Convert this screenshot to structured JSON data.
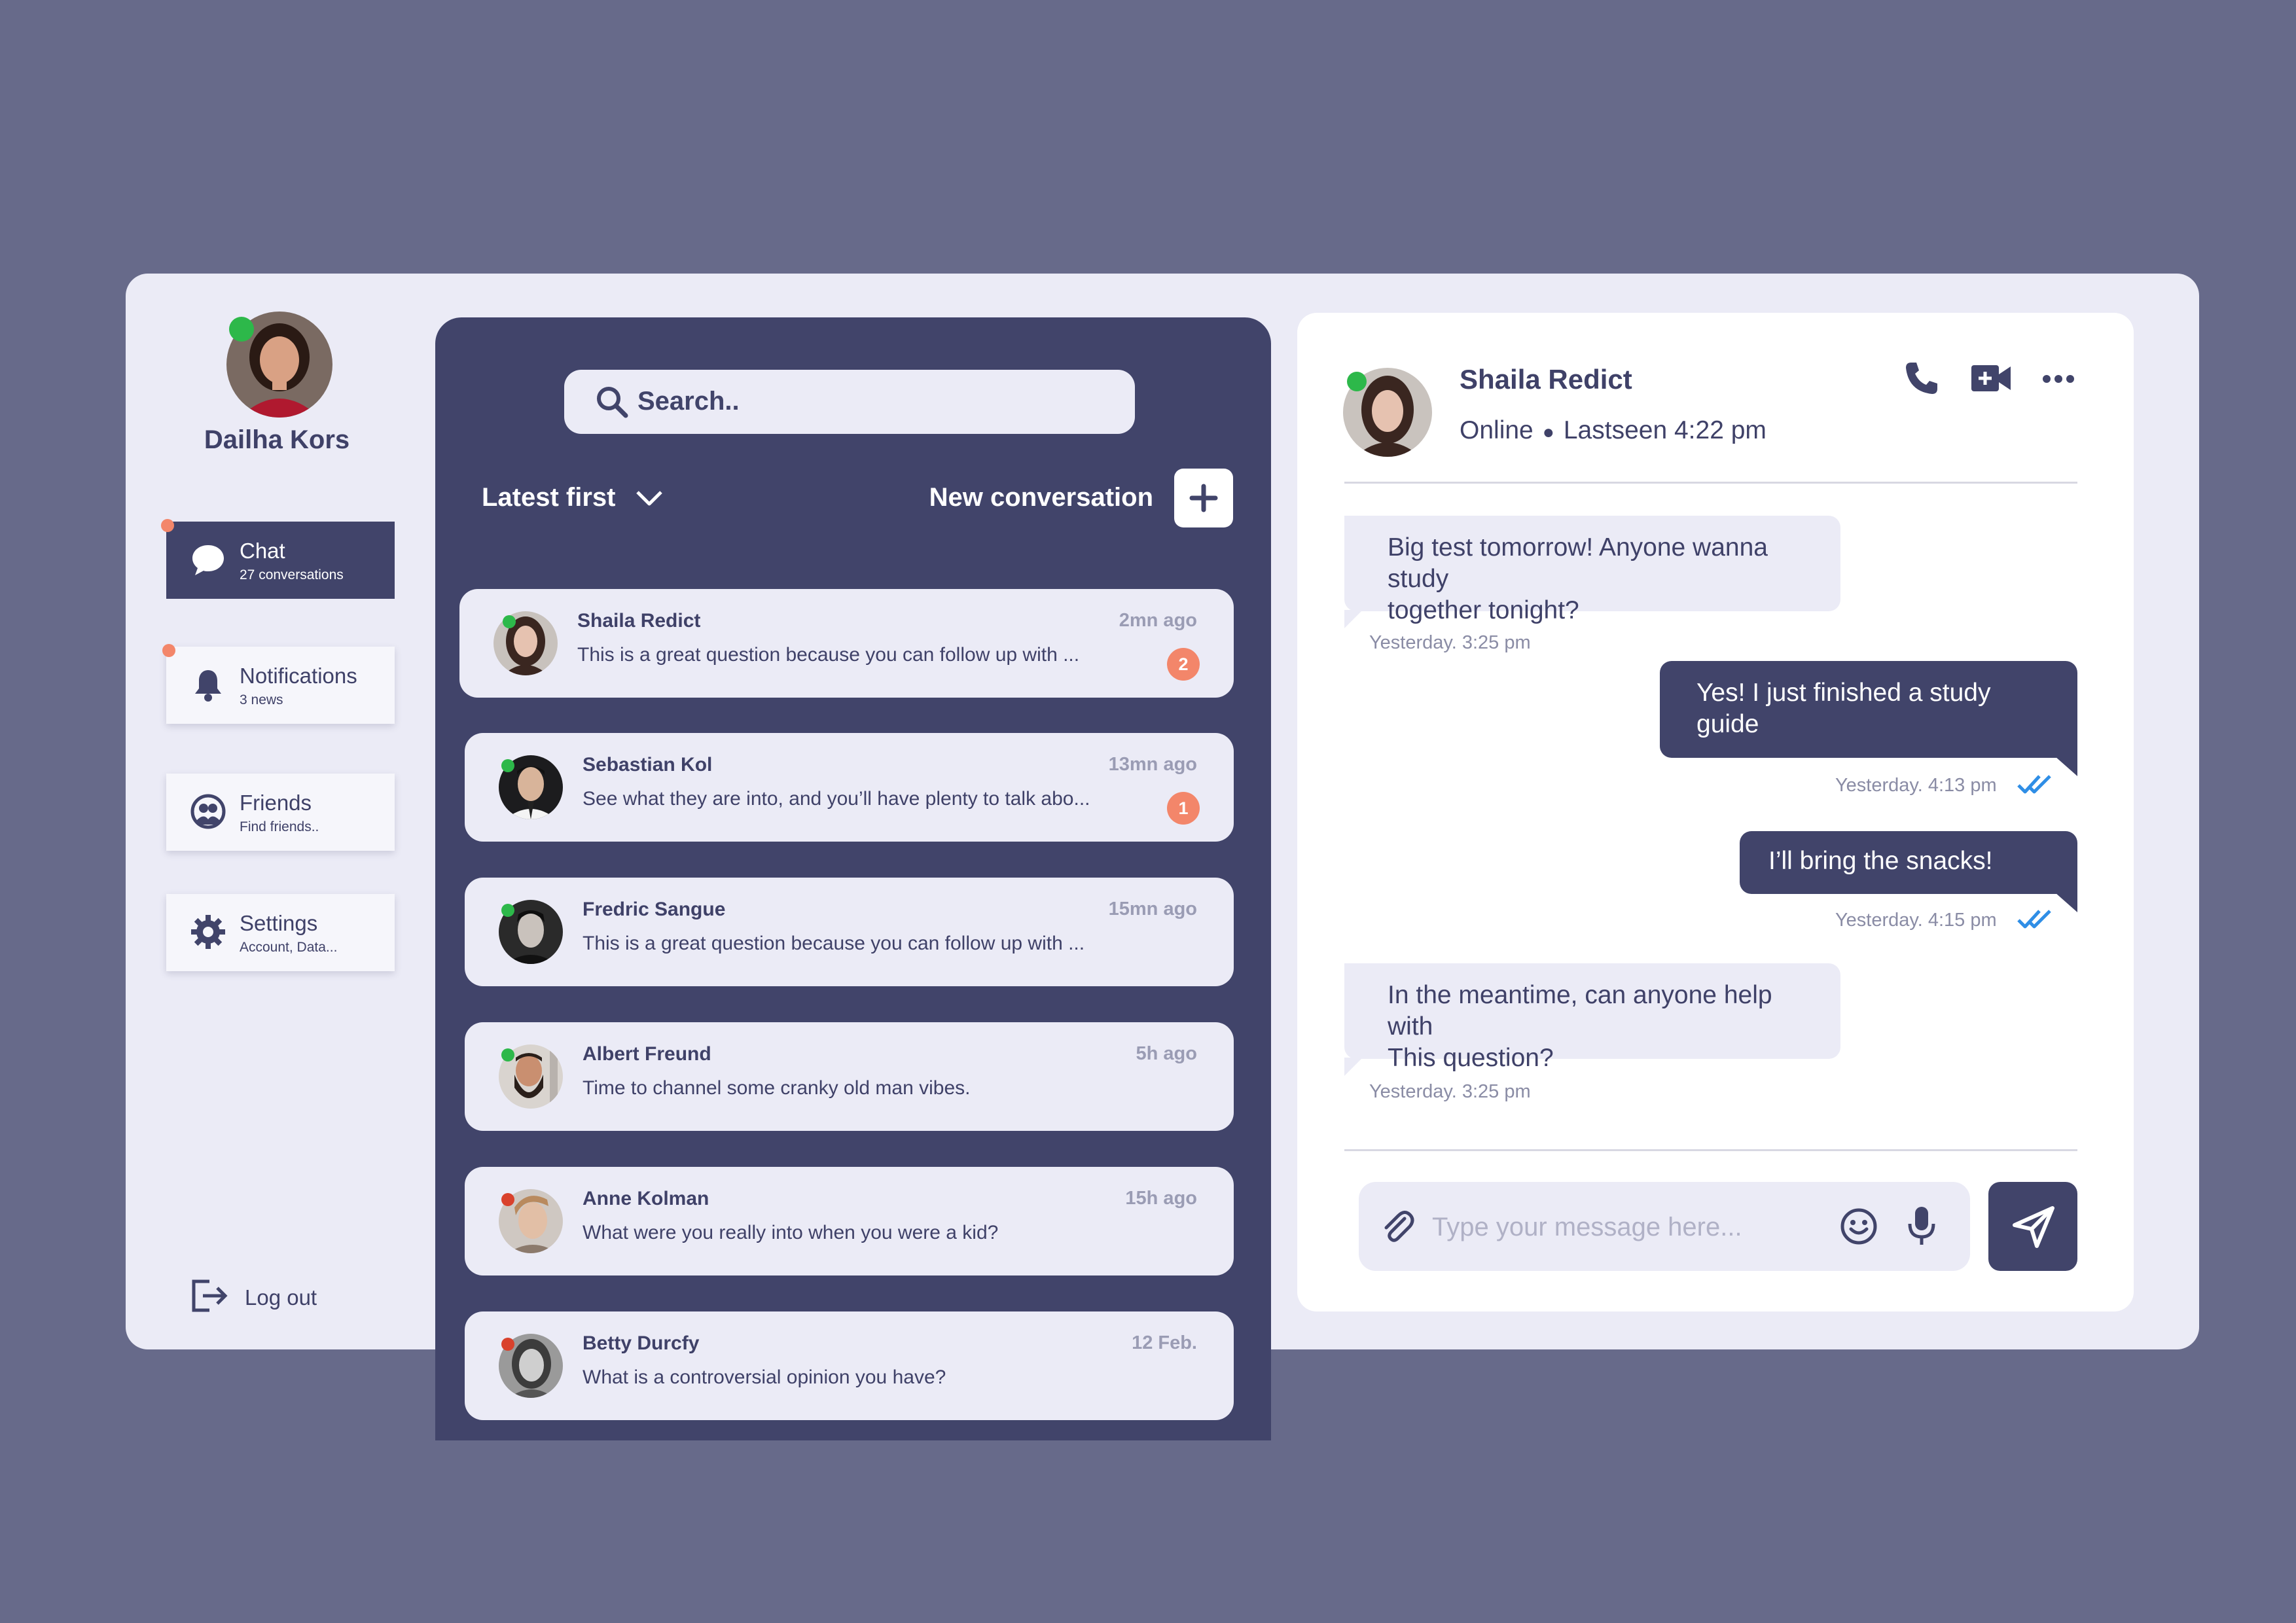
{
  "user": {
    "name": "Dailha Kors",
    "online": true
  },
  "nav": [
    {
      "title": "Chat",
      "subtitle": "27 conversations",
      "icon": "chat-bubble-icon",
      "active": true,
      "badge": true
    },
    {
      "title": "Notifications",
      "subtitle": "3 news",
      "icon": "bell-icon",
      "active": false,
      "badge": true
    },
    {
      "title": "Friends",
      "subtitle": "Find friends..",
      "icon": "friends-icon",
      "active": false,
      "badge": false
    },
    {
      "title": "Settings",
      "subtitle": "Account, Data...",
      "icon": "gear-icon",
      "active": false,
      "badge": false
    }
  ],
  "logout": {
    "label": "Log out",
    "icon": "logout-icon"
  },
  "list": {
    "search_placeholder": "Search..",
    "sort_label": "Latest first",
    "new_label": "New conversation"
  },
  "conversations": [
    {
      "name": "Shaila Redict",
      "time": "2mn ago",
      "message": "This is a great question because you can follow up with ...",
      "unread": "2",
      "online": true
    },
    {
      "name": "Sebastian Kol",
      "time": "13mn ago",
      "message": "See what they are into, and you’ll have plenty to talk abo...",
      "unread": "1",
      "online": true
    },
    {
      "name": "Fredric Sangue",
      "time": "15mn ago",
      "message": "This is a great question because you can follow up with ...",
      "unread": "",
      "online": true
    },
    {
      "name": "Albert Freund",
      "time": "5h ago",
      "message": "Time to channel some cranky old man vibes.",
      "unread": "",
      "online": true
    },
    {
      "name": "Anne Kolman",
      "time": "15h ago",
      "message": " What were you really into when you were a kid?",
      "unread": "",
      "online": false
    },
    {
      "name": "Betty Durcfy",
      "time": "12 Feb.",
      "message": "What is a controversial opinion you have?",
      "unread": "",
      "online": false
    }
  ],
  "chat": {
    "contact_name": "Shaila Redict",
    "status": "Online",
    "last_seen": "Lastseen 4:22 pm",
    "messages": [
      {
        "direction": "in",
        "lines": [
          "Big test tomorrow! Anyone wanna study",
          "together tonight?"
        ],
        "time": "Yesterday. 3:25 pm",
        "read": false
      },
      {
        "direction": "out",
        "lines": [
          "Yes! I just finished a study",
          "guide"
        ],
        "time": "Yesterday. 4:13 pm",
        "read": true
      },
      {
        "direction": "out",
        "lines": [
          "I’ll bring the snacks!"
        ],
        "time": "Yesterday. 4:15 pm",
        "read": true
      },
      {
        "direction": "in",
        "lines": [
          "In the meantime, can anyone help with",
          "This question?"
        ],
        "time": "Yesterday. 3:25 pm",
        "read": false
      }
    ],
    "composer_placeholder": "Type your message here..."
  },
  "colors": {
    "background": "#676a8a",
    "panel": "#41446a",
    "light": "#ebebf6",
    "online": "#2db84a",
    "offline": "#d9412c",
    "badge": "#f3866a",
    "read_tick": "#2f8ee6"
  }
}
